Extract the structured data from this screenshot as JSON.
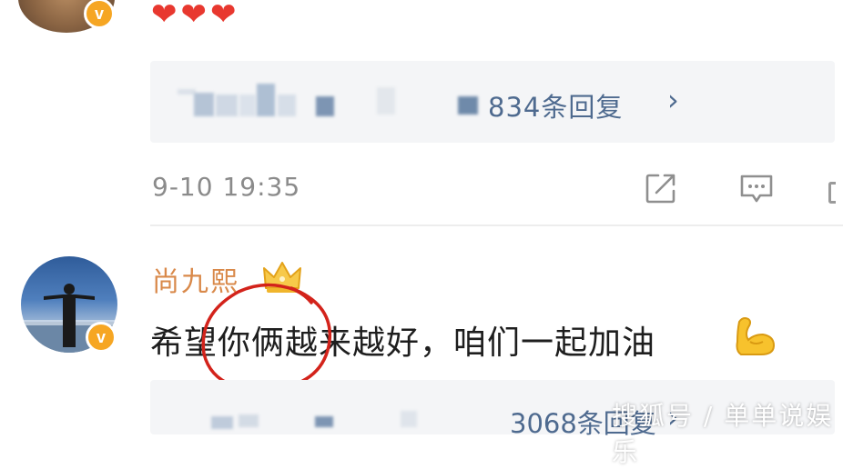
{
  "comment1": {
    "hearts": [
      "❤",
      "❤",
      "❤"
    ],
    "reply_preview": {
      "reply_count_text": "834条回复",
      "chevron": "›"
    },
    "timestamp": "9-10 19:35",
    "actions": {
      "share_icon": "share-icon",
      "comment_icon": "comment-icon"
    }
  },
  "comment2": {
    "username": "尚九熙",
    "text": "希望你俩越来越好，咱们一起加油",
    "emoji": "flexed-biceps",
    "reply_preview": {
      "reply_count_text": "3068条回复",
      "chevron": "›"
    }
  },
  "badges": {
    "verified_letter": "v",
    "verified_color": "#f6a623"
  },
  "watermark": "搜狐号 / 单单说娱乐",
  "colors": {
    "heart": "#e8382f",
    "link": "#4e6a8f",
    "username": "#d9894a",
    "annotation_circle": "#d3231b"
  }
}
